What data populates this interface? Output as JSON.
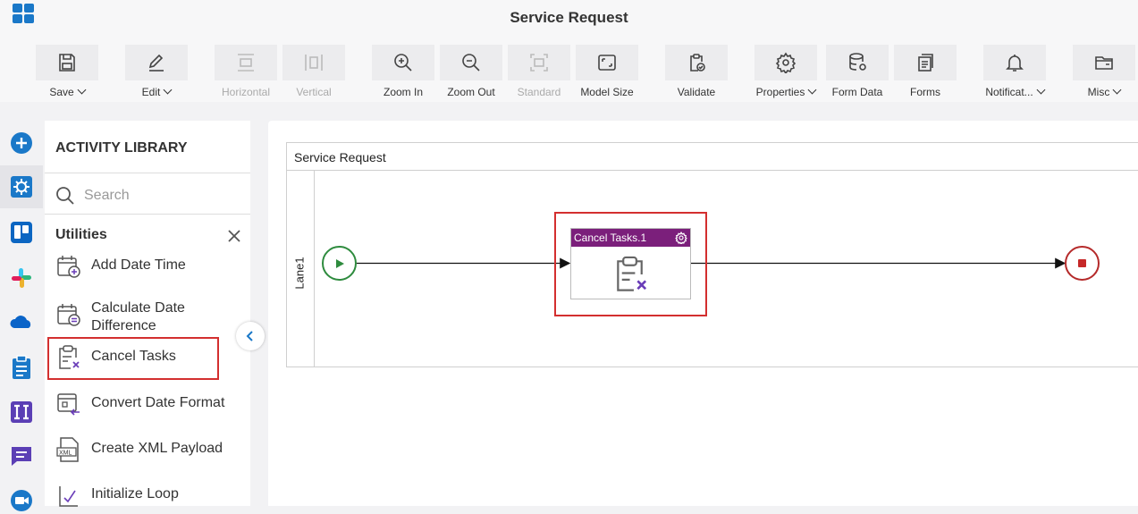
{
  "app": {
    "title": "Service Request"
  },
  "toolbar": {
    "save": "Save",
    "edit": "Edit",
    "horizontal": "Horizontal",
    "vertical": "Vertical",
    "zoom_in": "Zoom In",
    "zoom_out": "Zoom Out",
    "standard": "Standard",
    "model_size": "Model Size",
    "validate": "Validate",
    "properties": "Properties",
    "form_data": "Form Data",
    "forms": "Forms",
    "notifications": "Notificat...",
    "misc": "Misc"
  },
  "library": {
    "title": "ACTIVITY LIBRARY",
    "search_placeholder": "Search",
    "category": "Utilities",
    "items": [
      {
        "label": "Add Date Time",
        "icon": "calendar-add-icon"
      },
      {
        "label": "Calculate Date Difference",
        "icon": "calendar-equals-icon"
      },
      {
        "label": "Cancel Tasks",
        "icon": "clipboard-cancel-icon"
      },
      {
        "label": "Convert Date Format",
        "icon": "calendar-convert-icon"
      },
      {
        "label": "Create XML Payload",
        "icon": "xml-file-icon"
      },
      {
        "label": "Initialize Loop",
        "icon": "loop-icon"
      }
    ]
  },
  "canvas": {
    "pool_title": "Service Request",
    "lane": "Lane1",
    "task": {
      "title": "Cancel Tasks.1",
      "icon": "clipboard-cancel-icon"
    }
  },
  "colors": {
    "accent": "#1a78c8",
    "task_header": "#7b1f7b",
    "start_event": "#2e8b3e",
    "end_event": "#b52a2a",
    "highlight": "#d32f2f"
  }
}
